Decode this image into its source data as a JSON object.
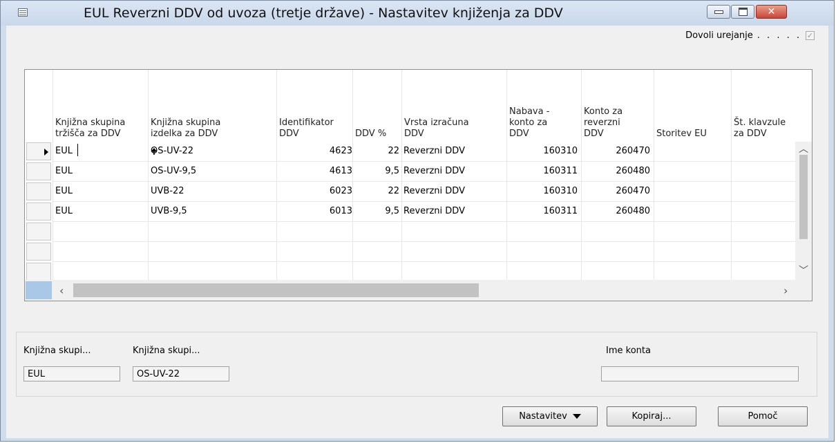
{
  "window": {
    "title": "EUL Reverzni DDV od uvoza (tretje države) - Nastavitev knjiženja za DDV",
    "allow_edit_label": "Dovoli urejanje",
    "allow_edit_dots": ". . . . .",
    "allow_edit_checked": true
  },
  "table": {
    "columns": [
      {
        "line1": "Knjižna skupina",
        "line2": "tržišča za DDV"
      },
      {
        "line1": "Knjižna skupina",
        "line2": "izdelka za DDV"
      },
      {
        "line1": "Identifikator",
        "line2": "DDV"
      },
      {
        "line1": "DDV %",
        "line2": ""
      },
      {
        "line1": "Vrsta izračuna",
        "line2": "DDV"
      },
      {
        "line1": "Nabava -",
        "line2": "konto za",
        "line3": "DDV"
      },
      {
        "line1": "Konto za",
        "line2": "reverzni",
        "line3": "DDV"
      },
      {
        "line1": "Storitev EU",
        "line2": ""
      },
      {
        "line1": "Št. klavzule",
        "line2": "za DDV"
      }
    ],
    "rows": [
      {
        "market": "EUL",
        "item": "OS-UV-22",
        "ident": "4623",
        "pct": "22",
        "calc": "Reverzni DDV",
        "purchase": "160310",
        "reverse": "260470"
      },
      {
        "market": "EUL",
        "item": "OS-UV-9,5",
        "ident": "4613",
        "pct": "9,5",
        "calc": "Reverzni DDV",
        "purchase": "160311",
        "reverse": "260480"
      },
      {
        "market": "EUL",
        "item": "UVB-22",
        "ident": "6023",
        "pct": "22",
        "calc": "Reverzni DDV",
        "purchase": "160310",
        "reverse": "260470"
      },
      {
        "market": "EUL",
        "item": "UVB-9,5",
        "ident": "6013",
        "pct": "9,5",
        "calc": "Reverzni DDV",
        "purchase": "160311",
        "reverse": "260480"
      }
    ]
  },
  "footer": {
    "field1_label": "Knjižna skupi...",
    "field1_value": "EUL",
    "field2_label": "Knjižna skupi...",
    "field2_value": "OS-UV-22",
    "account_label": "Ime konta",
    "account_value": ""
  },
  "buttons": {
    "setup": "Nastavitev",
    "copy": "Kopiraj...",
    "help": "Pomoč"
  }
}
